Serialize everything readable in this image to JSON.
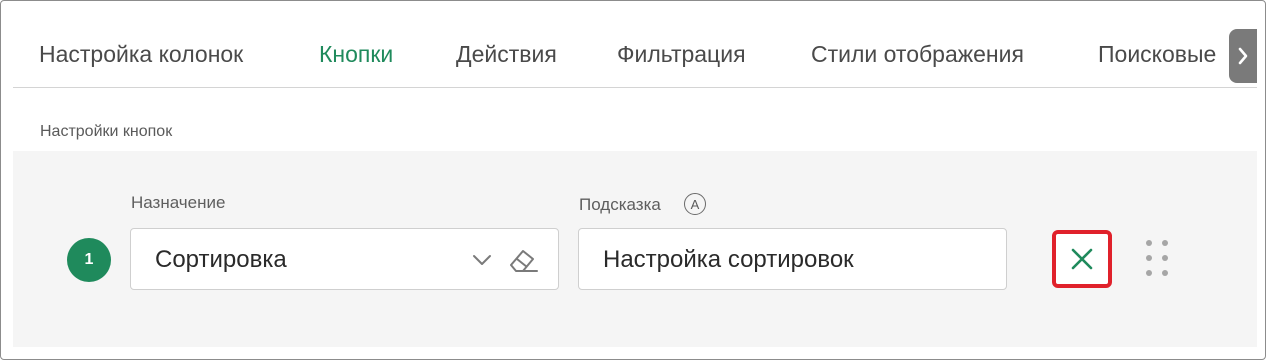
{
  "tabs": [
    {
      "label": "Настройка колонок",
      "active": false
    },
    {
      "label": "Кнопки",
      "active": true
    },
    {
      "label": "Действия",
      "active": false
    },
    {
      "label": "Фильтрация",
      "active": false
    },
    {
      "label": "Стили отображения",
      "active": false
    },
    {
      "label": "Поисковые",
      "active": false
    }
  ],
  "tab_scroll_icon": "chevron-right-icon",
  "section": {
    "title": "Настройки кнопок"
  },
  "button_row": {
    "index": "1",
    "purpose": {
      "label": "Назначение",
      "value": "Сортировка",
      "icons": [
        "chevron-down-icon",
        "eraser-icon"
      ]
    },
    "hint": {
      "label": "Подсказка",
      "value": "Настройка сортировок",
      "label_icon_glyph": "A"
    },
    "delete_icon": "close-icon",
    "drag_icon": "drag-handle-icon"
  },
  "colors": {
    "accent": "#1f8a5c",
    "highlight": "#e0212b"
  }
}
